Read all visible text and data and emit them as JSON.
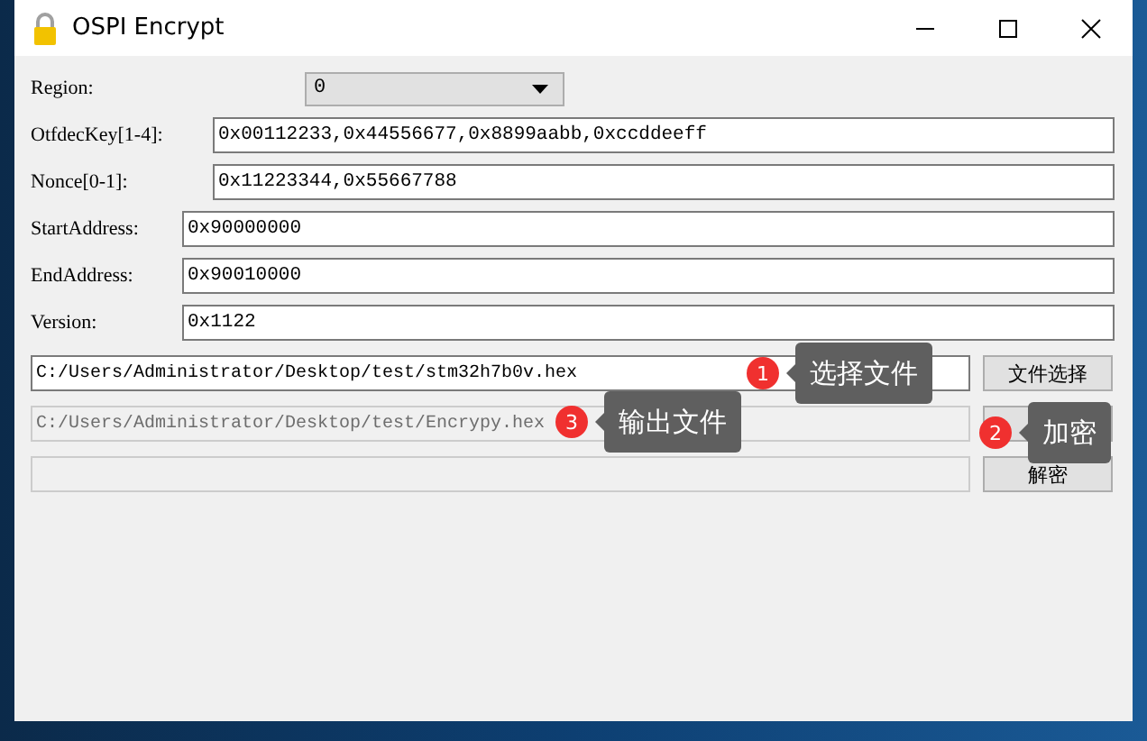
{
  "window": {
    "title": "OSPI Encrypt"
  },
  "region": {
    "label": "Region:",
    "value": "0"
  },
  "fields": [
    {
      "label": "OtfdecKey[1-4]:",
      "value": "0x00112233,0x44556677,0x8899aabb,0xccddeeff"
    },
    {
      "label": "Nonce[0-1]:",
      "value": "0x11223344,0x55667788"
    },
    {
      "label": "StartAddress:",
      "value": "0x90000000"
    },
    {
      "label": "EndAddress:",
      "value": "0x90010000"
    },
    {
      "label": "Version:",
      "value": "0x1122"
    }
  ],
  "file_rows": [
    {
      "value": "C:/Users/Administrator/Desktop/test/stm32h7b0v.hex",
      "disabled": false,
      "button": "文件选择"
    },
    {
      "value": "C:/Users/Administrator/Desktop/test/Encrypy.hex",
      "disabled": true,
      "button": ""
    },
    {
      "value": "",
      "disabled": true,
      "button": "解密"
    }
  ],
  "callouts": [
    {
      "number": "1",
      "text": "选择文件"
    },
    {
      "number": "3",
      "text": "输出文件"
    },
    {
      "number": "2",
      "text": "加密"
    }
  ]
}
